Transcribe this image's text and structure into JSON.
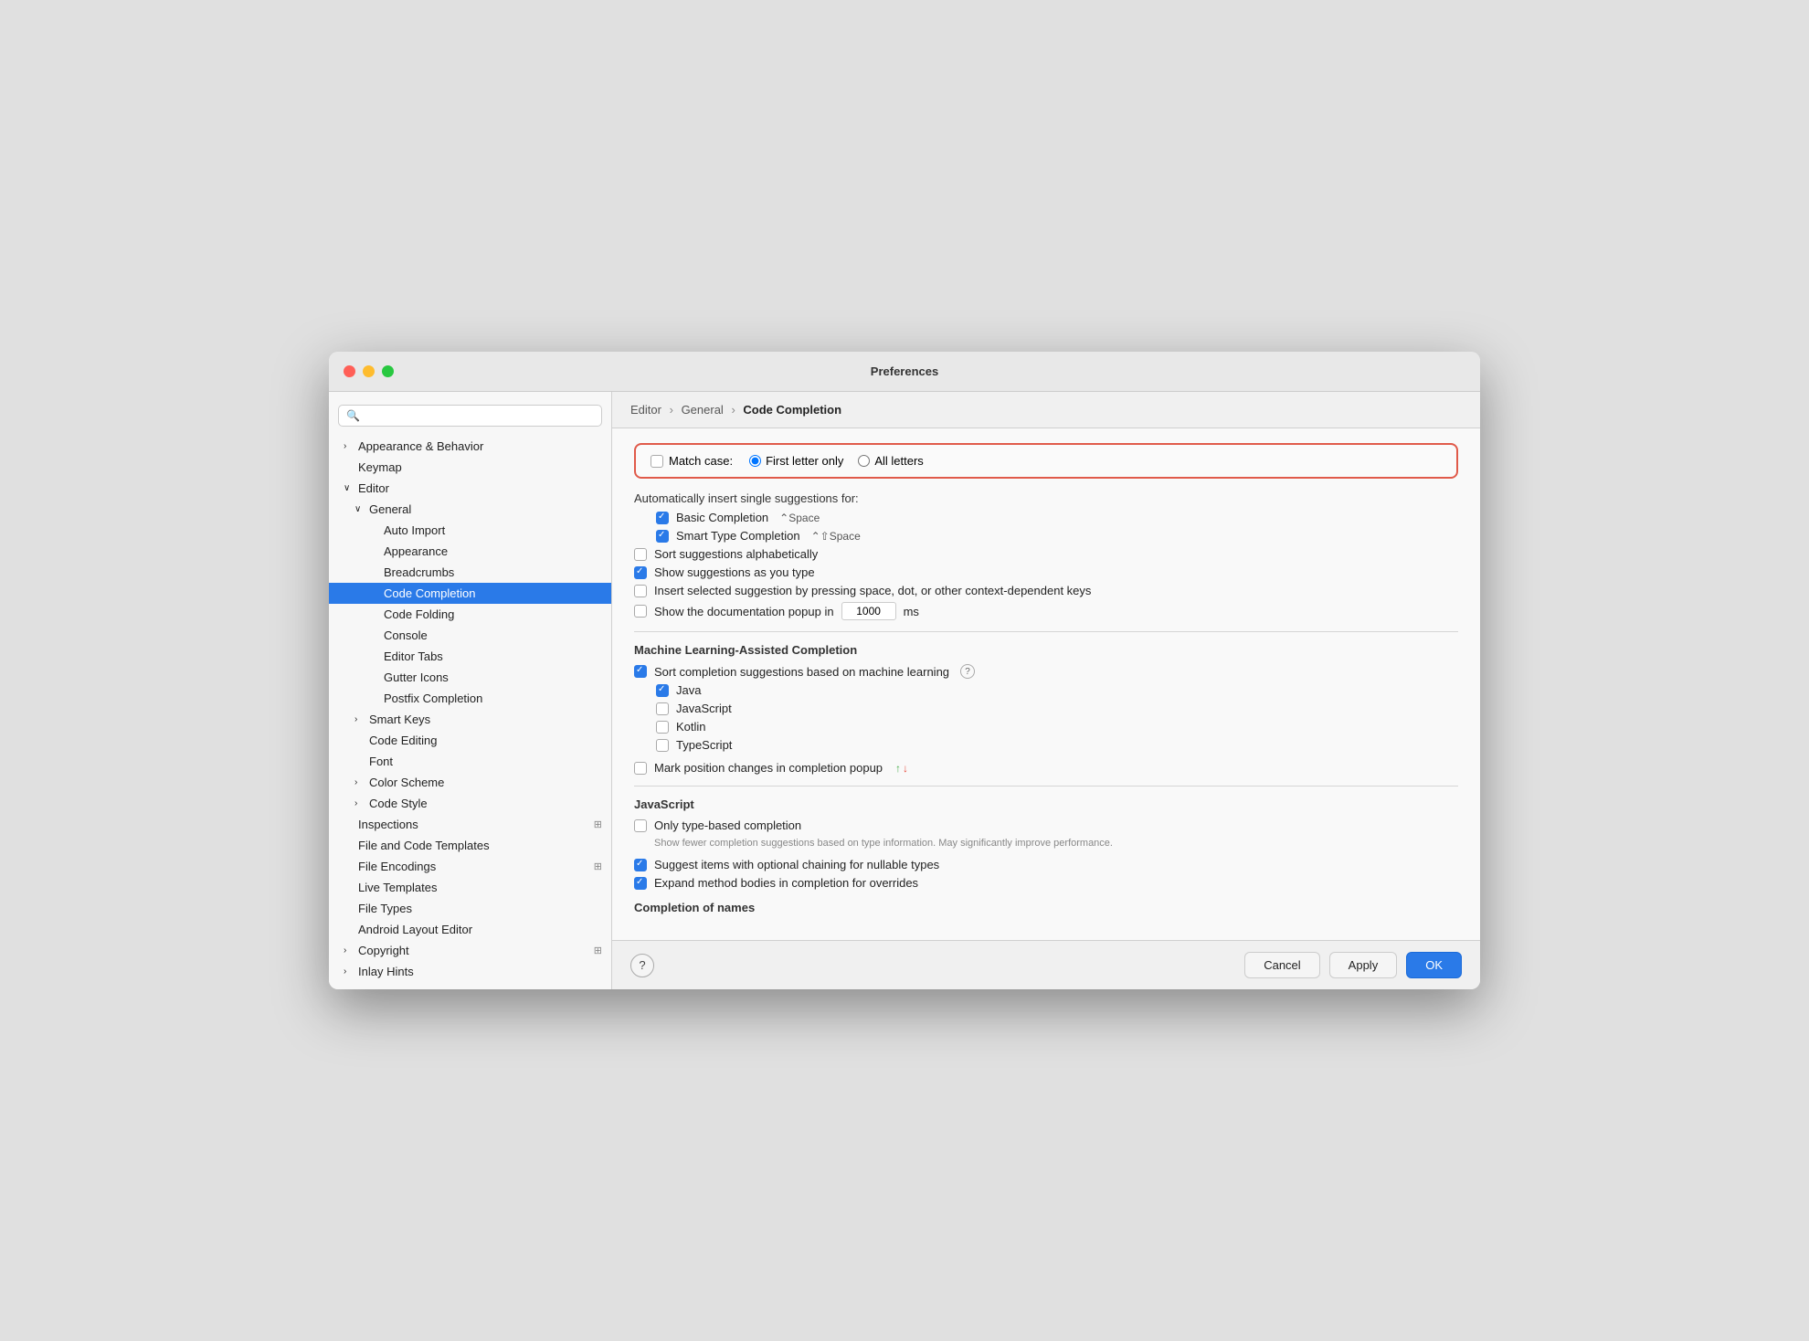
{
  "window": {
    "title": "Preferences"
  },
  "search": {
    "placeholder": "🔍"
  },
  "breadcrumb": {
    "parts": [
      "Editor",
      "General",
      "Code Completion"
    ],
    "active": "Code Completion"
  },
  "sidebar": {
    "items": [
      {
        "id": "appearance-behavior",
        "label": "Appearance & Behavior",
        "indent": 0,
        "chevron": "›",
        "expanded": false,
        "selected": false
      },
      {
        "id": "keymap",
        "label": "Keymap",
        "indent": 0,
        "chevron": "",
        "expanded": false,
        "selected": false
      },
      {
        "id": "editor",
        "label": "Editor",
        "indent": 0,
        "chevron": "∨",
        "expanded": true,
        "selected": false
      },
      {
        "id": "general",
        "label": "General",
        "indent": 1,
        "chevron": "∨",
        "expanded": true,
        "selected": false
      },
      {
        "id": "auto-import",
        "label": "Auto Import",
        "indent": 2,
        "chevron": "",
        "expanded": false,
        "selected": false
      },
      {
        "id": "appearance",
        "label": "Appearance",
        "indent": 2,
        "chevron": "",
        "expanded": false,
        "selected": false
      },
      {
        "id": "breadcrumbs",
        "label": "Breadcrumbs",
        "indent": 2,
        "chevron": "",
        "expanded": false,
        "selected": false
      },
      {
        "id": "code-completion",
        "label": "Code Completion",
        "indent": 2,
        "chevron": "",
        "expanded": false,
        "selected": true
      },
      {
        "id": "code-folding",
        "label": "Code Folding",
        "indent": 2,
        "chevron": "",
        "expanded": false,
        "selected": false
      },
      {
        "id": "console",
        "label": "Console",
        "indent": 2,
        "chevron": "",
        "expanded": false,
        "selected": false
      },
      {
        "id": "editor-tabs",
        "label": "Editor Tabs",
        "indent": 2,
        "chevron": "",
        "expanded": false,
        "selected": false
      },
      {
        "id": "gutter-icons",
        "label": "Gutter Icons",
        "indent": 2,
        "chevron": "",
        "expanded": false,
        "selected": false
      },
      {
        "id": "postfix-completion",
        "label": "Postfix Completion",
        "indent": 2,
        "chevron": "",
        "expanded": false,
        "selected": false
      },
      {
        "id": "smart-keys",
        "label": "Smart Keys",
        "indent": 1,
        "chevron": "›",
        "expanded": false,
        "selected": false
      },
      {
        "id": "code-editing",
        "label": "Code Editing",
        "indent": 1,
        "chevron": "",
        "expanded": false,
        "selected": false
      },
      {
        "id": "font",
        "label": "Font",
        "indent": 1,
        "chevron": "",
        "expanded": false,
        "selected": false
      },
      {
        "id": "color-scheme",
        "label": "Color Scheme",
        "indent": 1,
        "chevron": "›",
        "expanded": false,
        "selected": false
      },
      {
        "id": "code-style",
        "label": "Code Style",
        "indent": 1,
        "chevron": "›",
        "expanded": false,
        "selected": false
      },
      {
        "id": "inspections",
        "label": "Inspections",
        "indent": 0,
        "chevron": "",
        "badge": "⊞",
        "expanded": false,
        "selected": false
      },
      {
        "id": "file-code-templates",
        "label": "File and Code Templates",
        "indent": 0,
        "chevron": "",
        "expanded": false,
        "selected": false
      },
      {
        "id": "file-encodings",
        "label": "File Encodings",
        "indent": 0,
        "chevron": "",
        "badge": "⊞",
        "expanded": false,
        "selected": false
      },
      {
        "id": "live-templates",
        "label": "Live Templates",
        "indent": 0,
        "chevron": "",
        "expanded": false,
        "selected": false
      },
      {
        "id": "file-types",
        "label": "File Types",
        "indent": 0,
        "chevron": "",
        "expanded": false,
        "selected": false
      },
      {
        "id": "android-layout-editor",
        "label": "Android Layout Editor",
        "indent": 0,
        "chevron": "",
        "expanded": false,
        "selected": false
      },
      {
        "id": "copyright",
        "label": "Copyright",
        "indent": 0,
        "chevron": "›",
        "badge": "⊞",
        "expanded": false,
        "selected": false
      },
      {
        "id": "inlay-hints",
        "label": "Inlay Hints",
        "indent": 0,
        "chevron": "›",
        "expanded": false,
        "selected": false
      }
    ]
  },
  "settings": {
    "match_case_label": "Match case:",
    "first_letter_only": "First letter only",
    "all_letters": "All letters",
    "auto_insert_label": "Automatically insert single suggestions for:",
    "basic_completion": "Basic Completion",
    "basic_completion_shortcut": "⌃Space",
    "smart_type_completion": "Smart Type Completion",
    "smart_type_shortcut": "⌃⇧Space",
    "sort_alphabetically": "Sort suggestions alphabetically",
    "show_as_you_type": "Show suggestions as you type",
    "insert_by_space_dot": "Insert selected suggestion by pressing space, dot, or other context-dependent keys",
    "show_doc_popup": "Show the documentation popup in",
    "popup_ms_value": "1000",
    "popup_ms_unit": "ms",
    "ml_section_label": "Machine Learning-Assisted Completion",
    "ml_sort_label": "Sort completion suggestions based on machine learning",
    "ml_java": "Java",
    "ml_javascript": "JavaScript",
    "ml_kotlin": "Kotlin",
    "ml_typescript": "TypeScript",
    "mark_position_changes": "Mark position changes in completion popup",
    "js_section_label": "JavaScript",
    "js_type_based": "Only type-based completion",
    "js_type_based_desc": "Show fewer completion suggestions based on type information. May significantly improve performance.",
    "js_optional_chaining": "Suggest items with optional chaining for nullable types",
    "js_expand_method": "Expand method bodies in completion for overrides",
    "completion_of_names": "Completion of names",
    "checkboxes": {
      "match_case": false,
      "basic_completion": true,
      "smart_type_completion": true,
      "sort_alphabetically": false,
      "show_as_you_type": true,
      "insert_by_space": false,
      "show_doc_popup": false,
      "ml_sort": true,
      "ml_java": true,
      "ml_javascript": false,
      "ml_kotlin": false,
      "ml_typescript": false,
      "mark_position": false,
      "js_type_based": false,
      "js_optional_chaining": true,
      "js_expand_method": true
    },
    "radios": {
      "first_letter_only": true,
      "all_letters": false
    }
  },
  "buttons": {
    "cancel": "Cancel",
    "apply": "Apply",
    "ok": "OK",
    "help": "?"
  }
}
